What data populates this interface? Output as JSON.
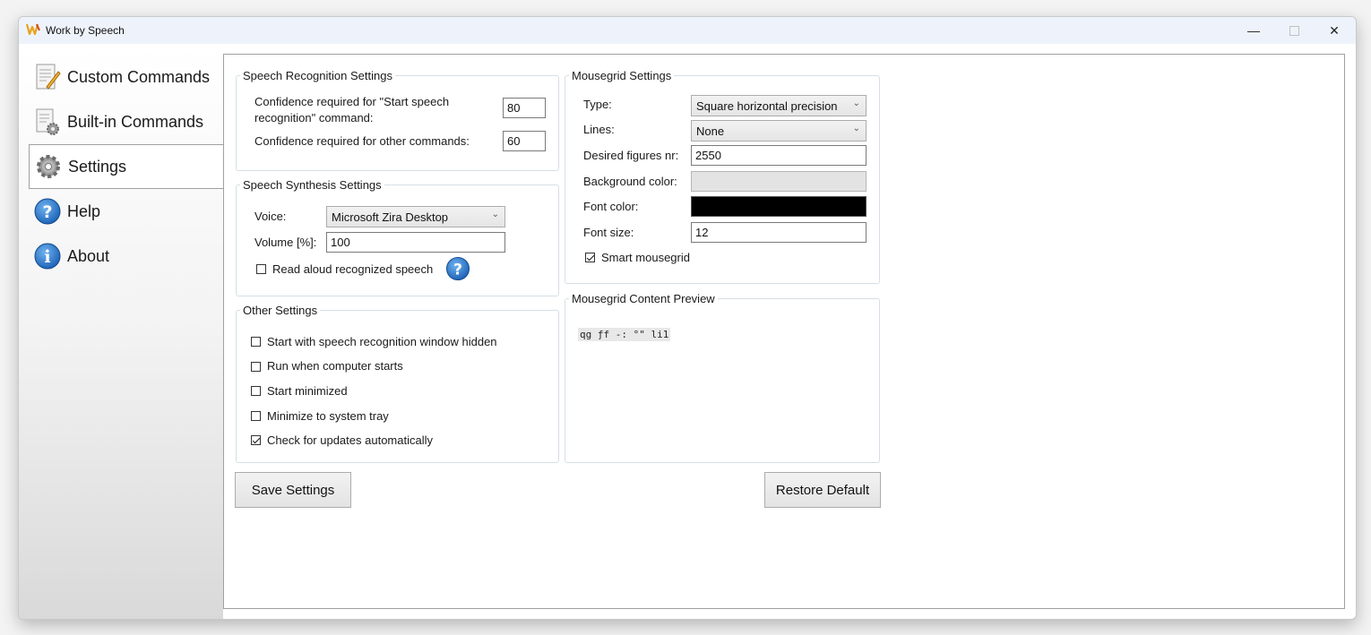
{
  "window": {
    "title": "Work by Speech"
  },
  "sidebar": {
    "items": [
      {
        "label": "Custom Commands",
        "icon": "notepad-pencil-icon"
      },
      {
        "label": "Built-in Commands",
        "icon": "document-gear-icon"
      },
      {
        "label": "Settings",
        "icon": "gear-icon",
        "selected": true
      },
      {
        "label": "Help",
        "icon": "help-icon"
      },
      {
        "label": "About",
        "icon": "info-icon"
      }
    ]
  },
  "speech_recognition": {
    "legend": "Speech Recognition Settings",
    "start_label": "Confidence required for \"Start speech recognition\" command:",
    "start_value": "80",
    "other_label": "Confidence required for other commands:",
    "other_value": "60"
  },
  "speech_synthesis": {
    "legend": "Speech Synthesis Settings",
    "voice_label": "Voice:",
    "voice_value": "Microsoft Zira Desktop",
    "volume_label": "Volume [%]:",
    "volume_value": "100",
    "read_aloud_label": "Read aloud recognized speech",
    "read_aloud_checked": false
  },
  "other_settings": {
    "legend": "Other Settings",
    "items": [
      {
        "label": "Start with speech recognition window hidden",
        "checked": false
      },
      {
        "label": "Run when computer starts",
        "checked": false
      },
      {
        "label": "Start minimized",
        "checked": false
      },
      {
        "label": "Minimize to system tray",
        "checked": false
      },
      {
        "label": "Check for updates automatically",
        "checked": true
      }
    ]
  },
  "mousegrid": {
    "legend": "Mousegrid Settings",
    "type_label": "Type:",
    "type_value": "Square horizontal precision",
    "lines_label": "Lines:",
    "lines_value": "None",
    "figures_label": "Desired figures nr:",
    "figures_value": "2550",
    "bg_label": "Background color:",
    "bg_color": "#e3e3e3",
    "font_color_label": "Font color:",
    "font_color": "#000000",
    "font_size_label": "Font size:",
    "font_size_value": "12",
    "smart_label": "Smart mousegrid",
    "smart_checked": true
  },
  "preview": {
    "legend": "Mousegrid Content Preview",
    "text": "qg ƒf -: °\" li1"
  },
  "buttons": {
    "save": "Save Settings",
    "restore": "Restore Default"
  }
}
